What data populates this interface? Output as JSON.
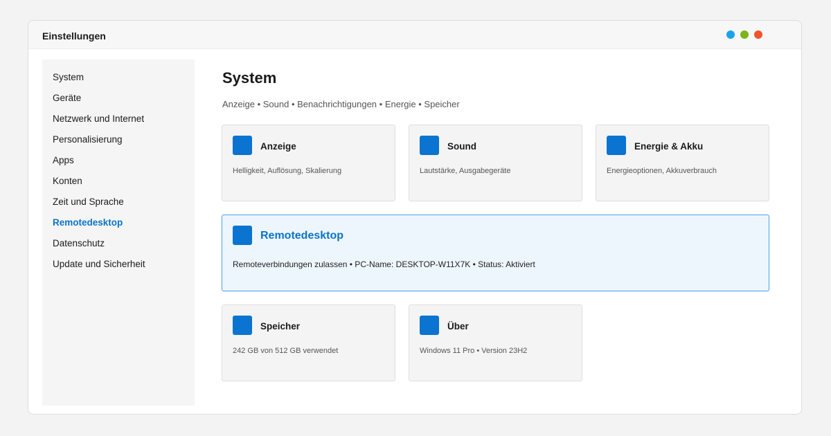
{
  "window": {
    "title": "Einstellungen",
    "controls": [
      {
        "name": "window-dot-blue",
        "color": "#1aa3ec"
      },
      {
        "name": "window-dot-green",
        "color": "#7cb518"
      },
      {
        "name": "window-dot-red",
        "color": "#ef5528"
      }
    ]
  },
  "sidebar": {
    "items": [
      {
        "label": "System"
      },
      {
        "label": "Geräte"
      },
      {
        "label": "Netzwerk und Internet"
      },
      {
        "label": "Personalisierung"
      },
      {
        "label": "Apps"
      },
      {
        "label": "Konten"
      },
      {
        "label": "Zeit und Sprache"
      },
      {
        "label": "Remotedesktop",
        "active": true
      },
      {
        "label": "Datenschutz"
      },
      {
        "label": "Update und Sicherheit"
      }
    ]
  },
  "main": {
    "title": "System",
    "breadcrumb": "Anzeige • Sound • Benachrichtigungen • Energie • Speicher",
    "cards": [
      {
        "icon": "display-icon",
        "title": "Anzeige",
        "desc": "Helligkeit, Auflösung, Skalierung"
      },
      {
        "icon": "sound-icon",
        "title": "Sound",
        "desc": "Lautstärke, Ausgabegeräte"
      },
      {
        "icon": "battery-icon",
        "title": "Energie & Akku",
        "desc": "Energieoptionen, Akkuverbrauch"
      },
      {
        "icon": "remote-desktop-icon",
        "title": "Remotedesktop",
        "desc": "Remoteverbindungen zulassen • PC-Name: DESKTOP-W11X7K • Status: Aktiviert"
      },
      {
        "icon": "storage-icon",
        "title": "Speicher",
        "desc": "242 GB von 512 GB verwendet"
      },
      {
        "icon": "info-icon",
        "title": "Über",
        "desc": "Windows 11 Pro • Version 23H2"
      }
    ]
  },
  "colors": {
    "accent": "#0a74c9",
    "icon": "#0a74d0",
    "highlight_bg": "#eef6fd",
    "highlight_border": "#4a9ee0"
  }
}
